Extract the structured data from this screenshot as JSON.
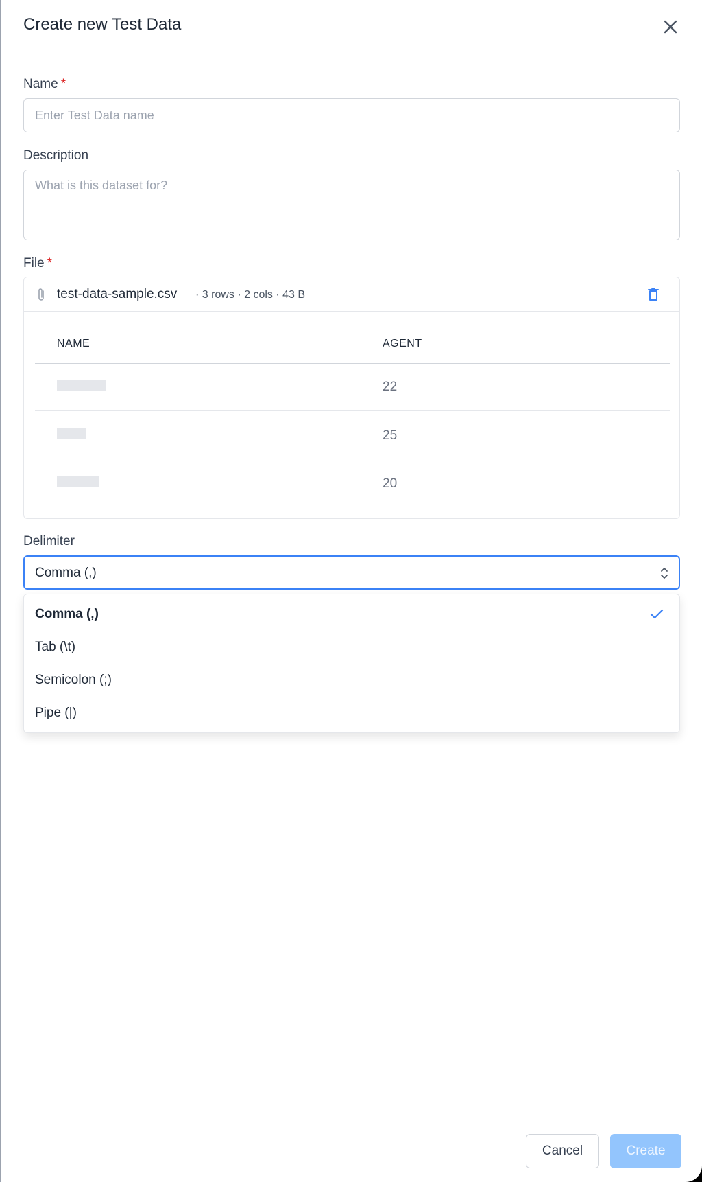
{
  "dialog": {
    "title": "Create new Test Data",
    "close_icon": "close-icon"
  },
  "fields": {
    "name": {
      "label": "Name",
      "required_mark": "*",
      "placeholder": "Enter Test Data name",
      "value": ""
    },
    "description": {
      "label": "Description",
      "placeholder": "What is this dataset for?",
      "value": ""
    },
    "file": {
      "label": "File",
      "required_mark": "*",
      "attachment_icon": "paperclip-icon",
      "file_name": "test-data-sample.csv",
      "meta": "· 3 rows · 2 cols · 43 B",
      "delete_icon": "trash-icon"
    }
  },
  "preview_table": {
    "columns": [
      "NAME",
      "AGENT"
    ],
    "rows": [
      {
        "name": "",
        "agent": "22"
      },
      {
        "name": "",
        "agent": "25"
      },
      {
        "name": "",
        "agent": "20"
      }
    ]
  },
  "delimiter": {
    "label": "Delimiter",
    "selected": "Comma (,)",
    "options": [
      "Comma (,)",
      "Tab (\\t)",
      "Semicolon (;)",
      "Pipe (|)"
    ],
    "selected_index": 0,
    "check_icon": "check-icon",
    "chevron_icon": "chevron-up-down-icon"
  },
  "footer": {
    "cancel_label": "Cancel",
    "create_label": "Create"
  },
  "colors": {
    "accent": "#3b82f6",
    "required": "#dc2626",
    "create_disabled_bg": "#93c5fd"
  }
}
